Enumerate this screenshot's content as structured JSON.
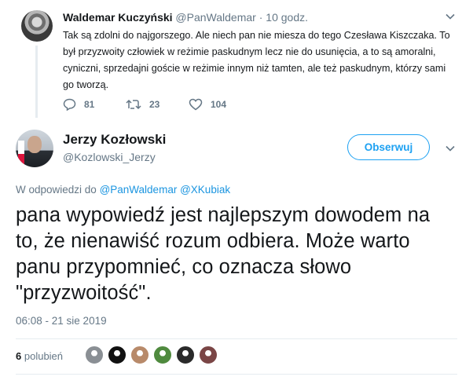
{
  "parent_tweet": {
    "author_name": "Waldemar Kuczyński",
    "author_handle": "@PanWaldemar",
    "separator": "·",
    "time_ago": "10 godz.",
    "text": "Tak są zdolni do najgorszego. Ale niech pan nie miesza do tego Czesława Kiszczaka. To był przyzwoity człowiek w reżimie paskudnym lecz nie do usunięcia, a to są amoralni, cyniczni, sprzedajni goście w reżimie innym niż tamten, ale też paskudnym, którzy sami go tworzą.",
    "replies": "81",
    "retweets": "23",
    "likes": "104"
  },
  "main_tweet": {
    "author_name": "Jerzy Kozłowski",
    "author_handle": "@Kozlowski_Jerzy",
    "follow_label": "Obserwuj",
    "reply_prefix": "W odpowiedzi do",
    "reply_mention_1": "@PanWaldemar",
    "reply_mention_2": "@XKubiak",
    "text": "pana wypowiedź jest najlepszym dowodem na to, że nienawiść rozum odbiera. Może warto panu przypomnieć, co oznacza słowo \"przyzwoitość\".",
    "timestamp": "06:08 - 21 sie 2019",
    "likes_count": "6",
    "likes_label": "polubień"
  },
  "colors": {
    "accent": "#1da1f2",
    "link": "#1b95e0",
    "secondary_text": "#657786",
    "divider": "#e6ecf0"
  },
  "liker_avatars": [
    {
      "name": "liker-avatar-1",
      "color": "#8a8f94"
    },
    {
      "name": "liker-avatar-2",
      "color": "#111111"
    },
    {
      "name": "liker-avatar-3",
      "color": "#b88a6a"
    },
    {
      "name": "liker-avatar-4",
      "color": "#4f8a3e"
    },
    {
      "name": "liker-avatar-5",
      "color": "#2a2a2a"
    },
    {
      "name": "liker-avatar-6",
      "color": "#7a4545"
    }
  ]
}
